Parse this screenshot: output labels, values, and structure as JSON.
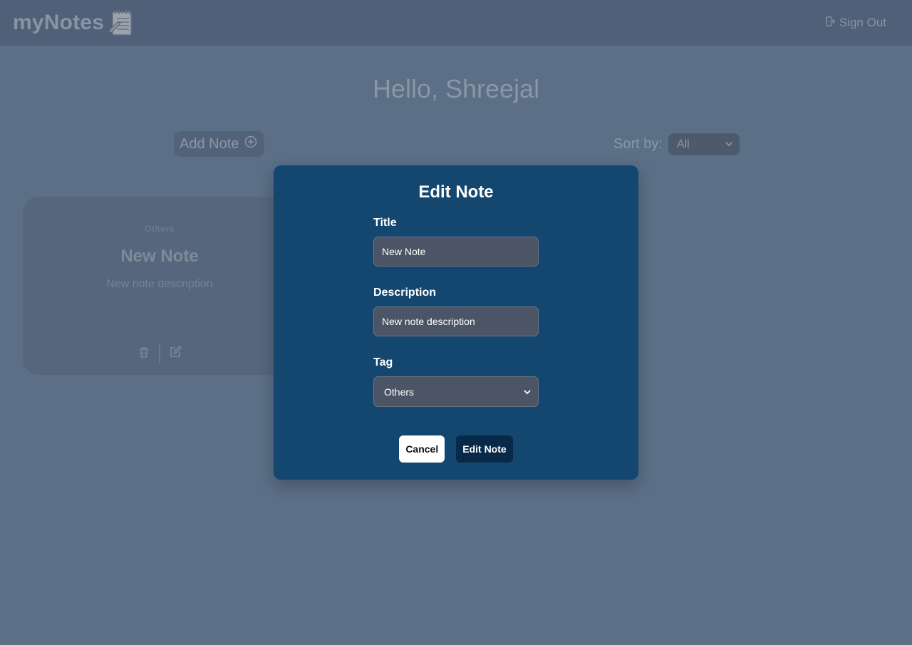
{
  "navbar": {
    "brand": "myNotes",
    "sign_out_label": "Sign Out"
  },
  "main": {
    "greeting": "Hello, Shreejal",
    "add_note_label": "Add Note",
    "sort_label": "Sort by:",
    "sort_value": "All"
  },
  "notes": [
    {
      "tag": "Others",
      "title": "New Note",
      "description": "New note description"
    }
  ],
  "modal": {
    "title": "Edit Note",
    "title_label": "Title",
    "title_value": "New Note",
    "description_label": "Description",
    "description_value": "New note description",
    "tag_label": "Tag",
    "tag_value": "Others",
    "cancel_label": "Cancel",
    "submit_label": "Edit Note"
  },
  "colors": {
    "modal_bg": "#14476f",
    "submit_bg": "#082a48",
    "overlay_bg": "#5b6f87"
  },
  "icons": [
    "notepad-icon",
    "sign-out-icon",
    "plus-circle-icon",
    "chevron-down-icon",
    "trash-icon",
    "edit-icon"
  ]
}
